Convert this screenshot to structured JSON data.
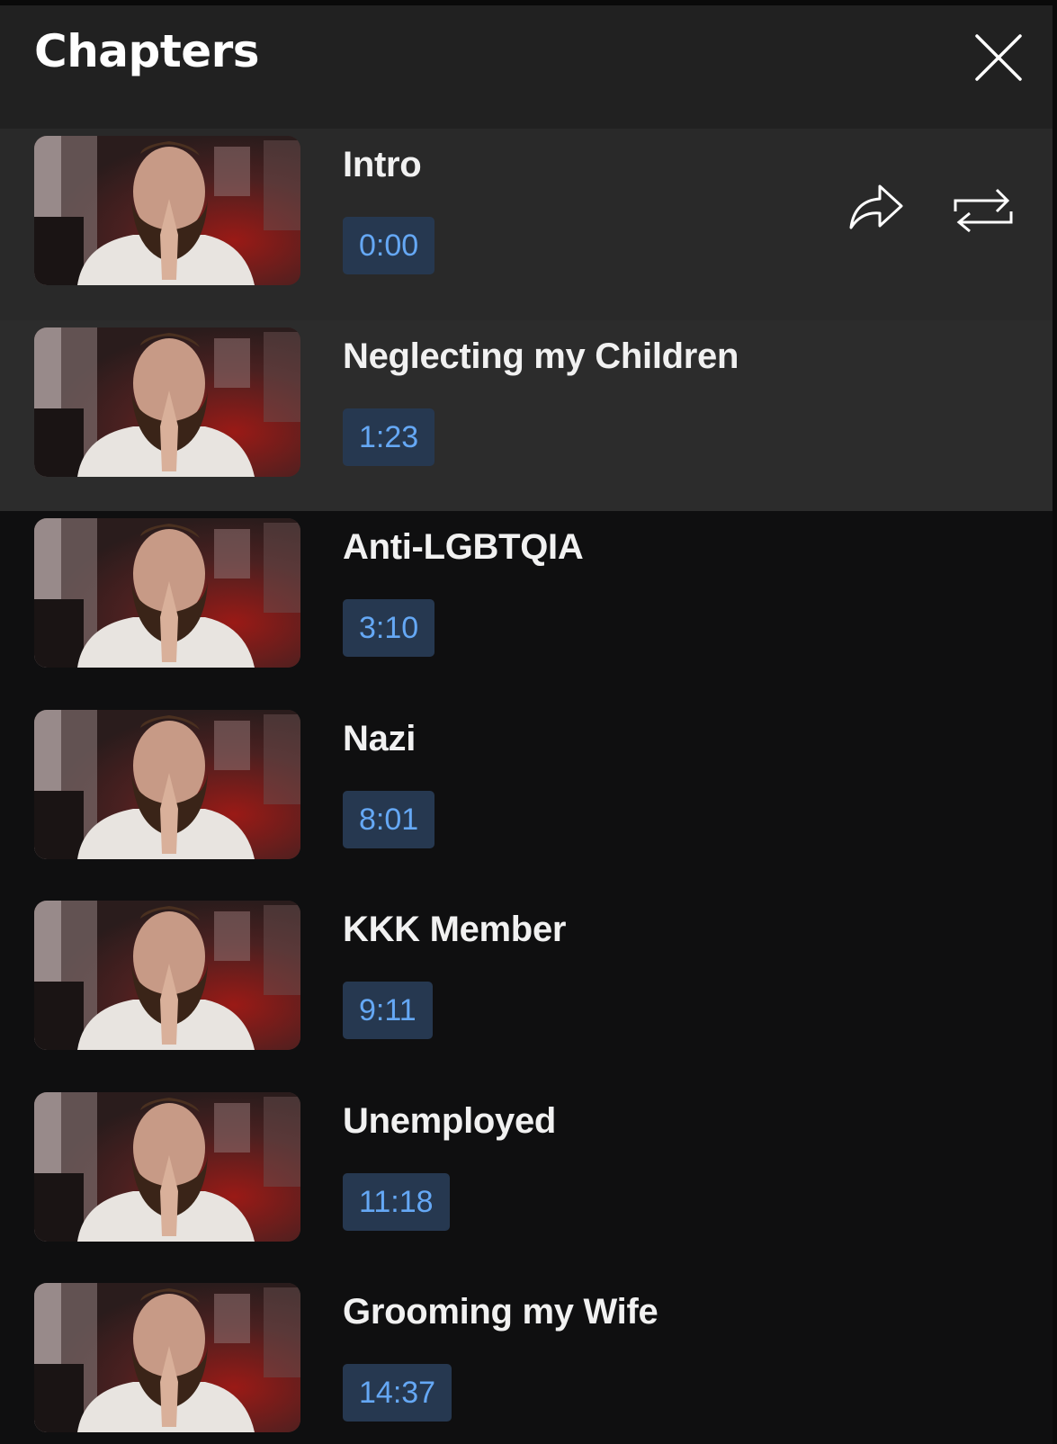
{
  "header": {
    "title": "Chapters",
    "close_icon": "close-icon"
  },
  "chapters": [
    {
      "title": "Intro",
      "time": "0:00"
    },
    {
      "title": "Neglecting my Children",
      "time": "1:23"
    },
    {
      "title": "Anti-LGBTQIA",
      "time": "3:10"
    },
    {
      "title": "Nazi",
      "time": "8:01"
    },
    {
      "title": "KKK Member",
      "time": "9:11"
    },
    {
      "title": "Unemployed",
      "time": "11:18"
    },
    {
      "title": "Grooming my Wife",
      "time": "14:37"
    }
  ],
  "actions": {
    "share_icon": "share-icon",
    "loop_icon": "loop-icon"
  },
  "colors": {
    "background": "#0f0f10",
    "header": "#212121",
    "active_row": "#292929",
    "timestamp_bg": "#263850",
    "timestamp_text": "#65a8f5"
  }
}
